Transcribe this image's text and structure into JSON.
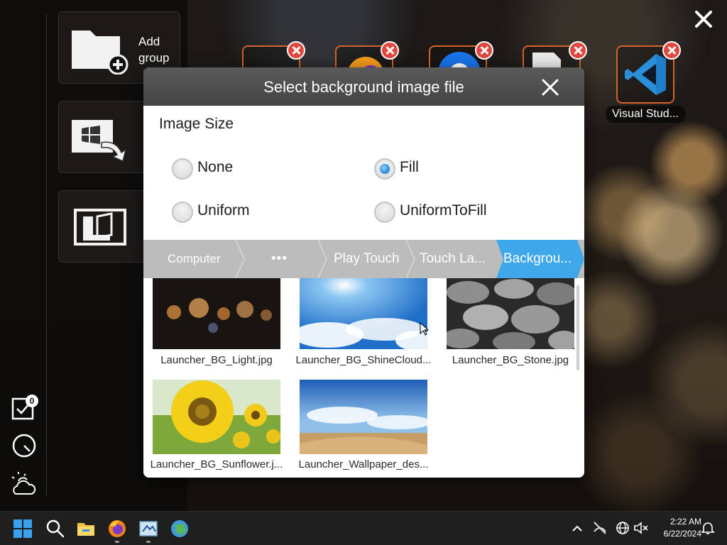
{
  "side_panel": {
    "tiles": [
      {
        "label": "Add group",
        "icon": "folder-add-icon"
      },
      {
        "label": "",
        "icon": "windows-import-icon"
      },
      {
        "label": "",
        "icon": "open-book-icon"
      }
    ],
    "task_badge_count": "0",
    "tools": [
      "task-checklist-icon",
      "clock-icon",
      "weather-icon"
    ]
  },
  "top_apps": {
    "tiles": [
      "blank-app-icon",
      "firefox-icon",
      "chrome-icon",
      "document-icon",
      "vscode-icon"
    ],
    "visible_label": "Visual Stud..."
  },
  "dialog": {
    "title": "Select background image file",
    "section_title": "Image Size",
    "options": [
      {
        "label": "None",
        "checked": false
      },
      {
        "label": "Fill",
        "checked": true
      },
      {
        "label": "Uniform",
        "checked": false
      },
      {
        "label": "UniformToFill",
        "checked": false
      }
    ],
    "breadcrumb": [
      "Computer",
      "•••",
      "Play Touch",
      "Touch La...",
      "Backgrou..."
    ],
    "images": [
      {
        "name": "Launcher_BG_Light.jpg"
      },
      {
        "name": "Launcher_BG_ShineCloud..."
      },
      {
        "name": "Launcher_BG_Stone.jpg"
      },
      {
        "name": "Launcher_BG_Sunflower.j..."
      },
      {
        "name": "Launcher_Wallpaper_des..."
      }
    ]
  },
  "taskbar": {
    "apps": [
      "windows-start-icon",
      "search-icon",
      "file-explorer-icon",
      "firefox-icon",
      "weather-app-icon",
      "globe-app-icon"
    ],
    "tray": [
      "chevron-up-icon",
      "network-off-icon",
      "globe-network-icon",
      "volume-muted-icon",
      "notification-icon"
    ],
    "time": "2:22 AM",
    "date": "6/22/2024"
  },
  "colors": {
    "accent_blue": "#3ea8ea",
    "tile_border": "#d4622a",
    "remove_red": "#e0483f"
  }
}
